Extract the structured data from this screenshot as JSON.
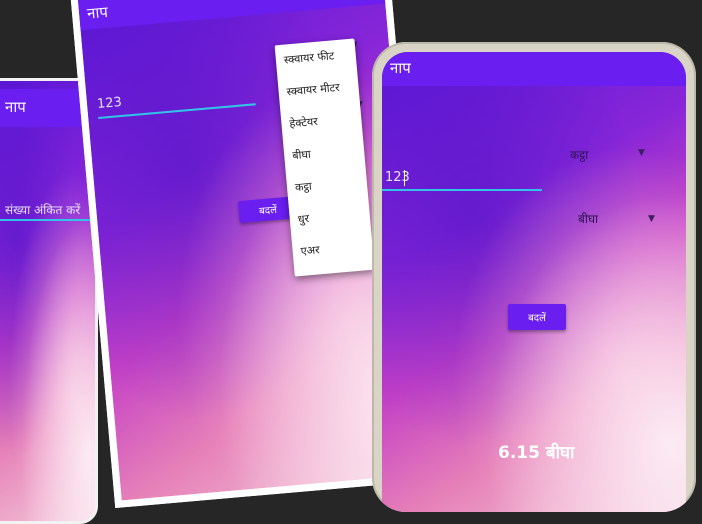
{
  "left_phone": {
    "title": "नाप",
    "input_placeholder": "संख्या अंकित करें"
  },
  "middle_phone": {
    "title": "नाप",
    "input_value": "123",
    "convert_button": "बदलें",
    "menu_items": [
      "स्क्वायर फीट",
      "स्क्वायर मीटर",
      "हेक्टेयर",
      "बीघा",
      "कट्ठा",
      "धुर",
      "एअर"
    ]
  },
  "right_phone": {
    "title": "नाप",
    "from_unit": "कट्ठा",
    "input_value": "123",
    "to_unit": "बीघा",
    "convert_button": "बदलें",
    "result": "6.15 बीघा"
  },
  "colors": {
    "app_bar": "#6a1ef0",
    "input_underline": "#34c3e8",
    "background": "#262626"
  },
  "icons": [
    "dropdown-arrow-icon"
  ]
}
